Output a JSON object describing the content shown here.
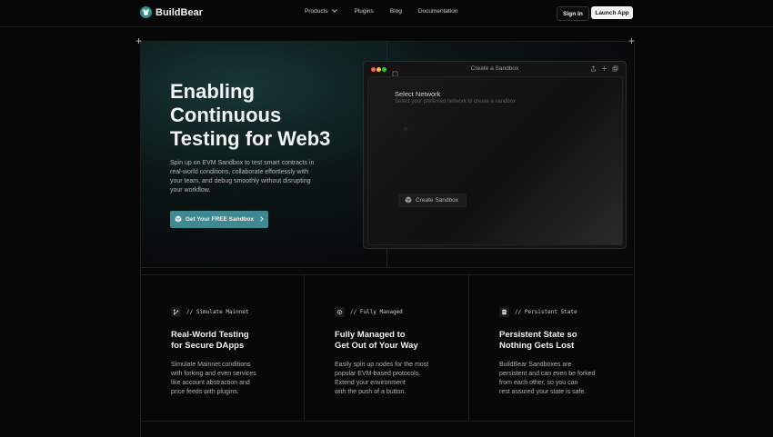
{
  "brand": {
    "name": "BuildBear"
  },
  "nav": {
    "items": [
      {
        "label": "Products",
        "has_dropdown": true
      },
      {
        "label": "Plugins"
      },
      {
        "label": "Blog"
      },
      {
        "label": "Documentation"
      }
    ],
    "sign_in": "Sign In",
    "launch_app": "Launch App"
  },
  "hero": {
    "title_lines": [
      "Enabling",
      "Continuous",
      "Testing for Web3"
    ],
    "description": "Spin up on EVM Sandbox to test smart contracts in real-world conditions, collaborate effortlessly with your team, and debug smoothly without disrupting your workflow.",
    "cta_label": "Get Your FREE Sandbox"
  },
  "sandbox_window": {
    "title": "Create a Sandbox",
    "select_title": "Select Network",
    "select_subtitle": "Select your preferred network to create a sandbox",
    "create_button": "Create Sandbox"
  },
  "features": [
    {
      "tag": "// Simulate Mainnet",
      "icon": "git-branch-icon",
      "title_lines": [
        "Real-World Testing",
        "for Secure DApps"
      ],
      "desc_lines": [
        "Simulate Mainnet conditions",
        "with forking and even services",
        "like account abstraction and",
        "price feeds with plugins."
      ]
    },
    {
      "tag": "// Fully Managed",
      "icon": "gear-icon",
      "title_lines": [
        "Fully Managed to",
        "Get Out of Your Way"
      ],
      "desc_lines": [
        "Easily spin up nodes for the most",
        "popular EVM-based protocols.",
        "Extend your environment",
        "with the push of a button."
      ]
    },
    {
      "tag": "// Persistent State",
      "icon": "document-icon",
      "title_lines": [
        "Persistent State so",
        "Nothing Gets Lost"
      ],
      "desc_lines": [
        "BuildBear Sandboxes are",
        "persistent and can even be forked",
        "from each other, so you can",
        "rest assured your state is safe."
      ]
    }
  ],
  "colors": {
    "accent": "#3f8a91",
    "background": "#070707"
  }
}
